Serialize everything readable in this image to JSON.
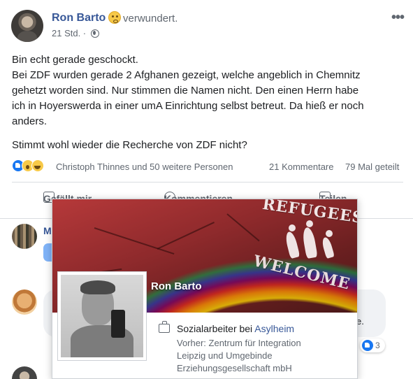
{
  "post": {
    "author": "Ron Barto",
    "feeling": "verwundert.",
    "time": "21 Std. ·",
    "more": "•••",
    "paragraph1_lines": [
      "Bin echt gerade geschockt.",
      "Bei ZDF wurden gerade 2 Afghanen gezeigt, welche angeblich in Chemnitz",
      "gehetzt worden sind. Nur stimmen die Namen nicht. Den einen Herrn habe",
      "ich in Hoyerswerda in einer umA Einrichtung selbst betreut. Da hieß er noch",
      "anders."
    ],
    "paragraph2": "Stimmt wohl wieder die Recherche von ZDF nicht?",
    "reaction_names": "Christoph Thinnes und 50 weitere Personen",
    "comments_count": "21 Kommentare",
    "shares_count": "79 Mal geteilt",
    "actions": {
      "like": "Gefällt mir",
      "comment": "Kommentieren",
      "share": "Teilen"
    }
  },
  "comments": {
    "first_name_partial": "M",
    "bubble_edge_text": "e.",
    "reaction_count": "3"
  },
  "hovercard": {
    "name": "Ron Barto",
    "cover_text_top": "REFUGEES",
    "cover_text_bottom": "WELCOME",
    "job_prefix": "Sozialarbeiter bei ",
    "job_employer": "Asylheim",
    "previous_lines": [
      "Vorher: Zentrum für Integration",
      "Leipzig und Umgebinde",
      "Erziehungsgesellschaft mbH"
    ]
  },
  "colors": {
    "link": "#385898",
    "secondary_text": "#606770",
    "like_blue": "#1877f2"
  },
  "icons": [
    "feeling-emoji-icon",
    "globe-icon",
    "more-icon",
    "like-reaction-icon",
    "wow-reaction-icon",
    "haha-reaction-icon",
    "briefcase-icon"
  ]
}
